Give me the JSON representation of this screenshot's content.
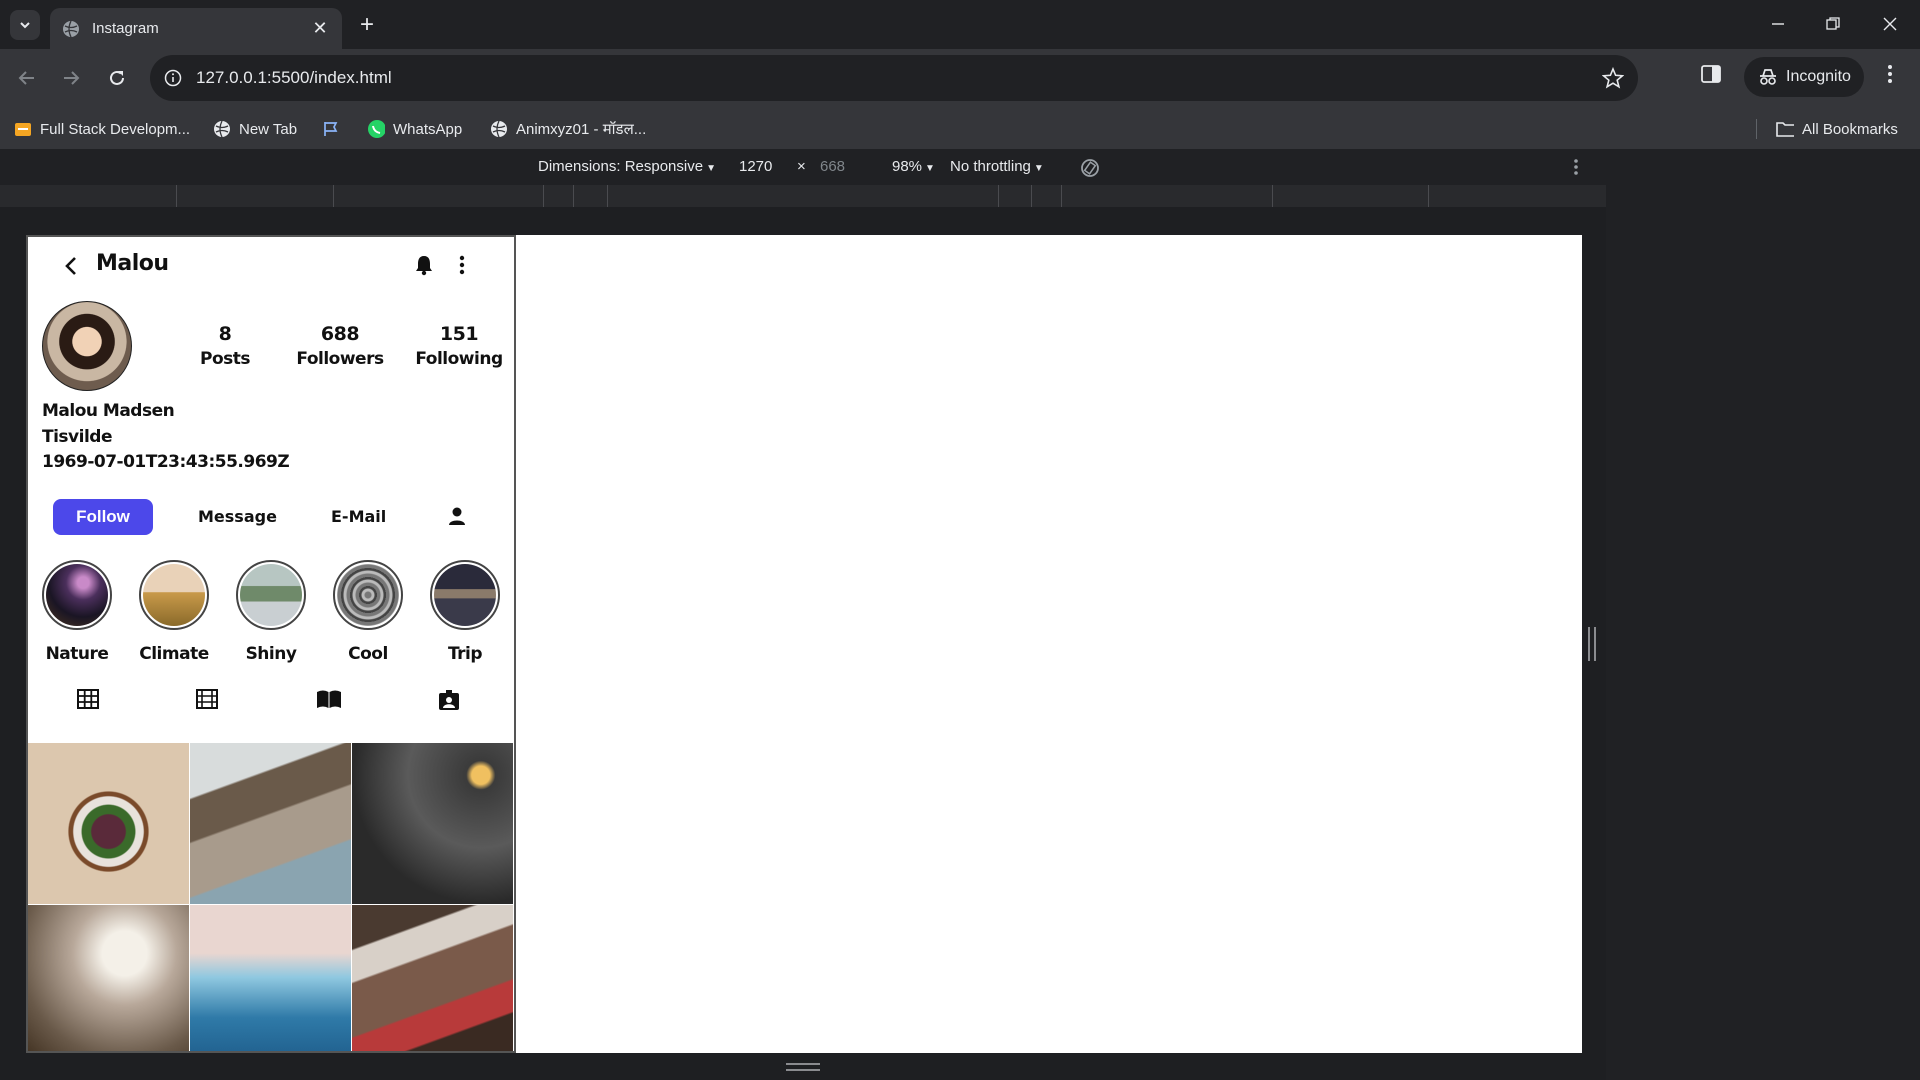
{
  "browser": {
    "tab_title": "Instagram",
    "url": "127.0.0.1:5500/index.html",
    "incognito_label": "Incognito",
    "bookmarks": [
      {
        "label": "Full Stack Developm...",
        "icon": "folder-orange-icon"
      },
      {
        "label": "New Tab",
        "icon": "globe-icon"
      },
      {
        "label": "",
        "icon": "flag-icon"
      },
      {
        "label": "WhatsApp",
        "icon": "whatsapp-icon"
      },
      {
        "label": "Animxyz01 - मॉडल...",
        "icon": "globe-icon"
      }
    ],
    "all_bookmarks": "All Bookmarks"
  },
  "device": {
    "dimensions_label": "Dimensions: Responsive",
    "width": "1270",
    "times": "×",
    "height": "668",
    "zoom": "98%",
    "throttling": "No throttling"
  },
  "profile": {
    "username": "Malou",
    "posts_count": "8",
    "posts_label": "Posts",
    "followers_count": "688",
    "followers_label": "Followers",
    "following_count": "151",
    "following_label": "Following",
    "full_name": "Malou Madsen",
    "location": "Tisvilde",
    "date": "1969-07-01T23:43:55.969Z",
    "follow_label": "Follow",
    "message_label": "Message",
    "email_label": "E-Mail",
    "highlights": [
      "Nature",
      "Climate",
      "Shiny",
      "Cool",
      "Trip"
    ]
  },
  "colors": {
    "follow_button": "#4c48ea",
    "chrome_dark": "#202124",
    "chrome_mid": "#35363a"
  }
}
